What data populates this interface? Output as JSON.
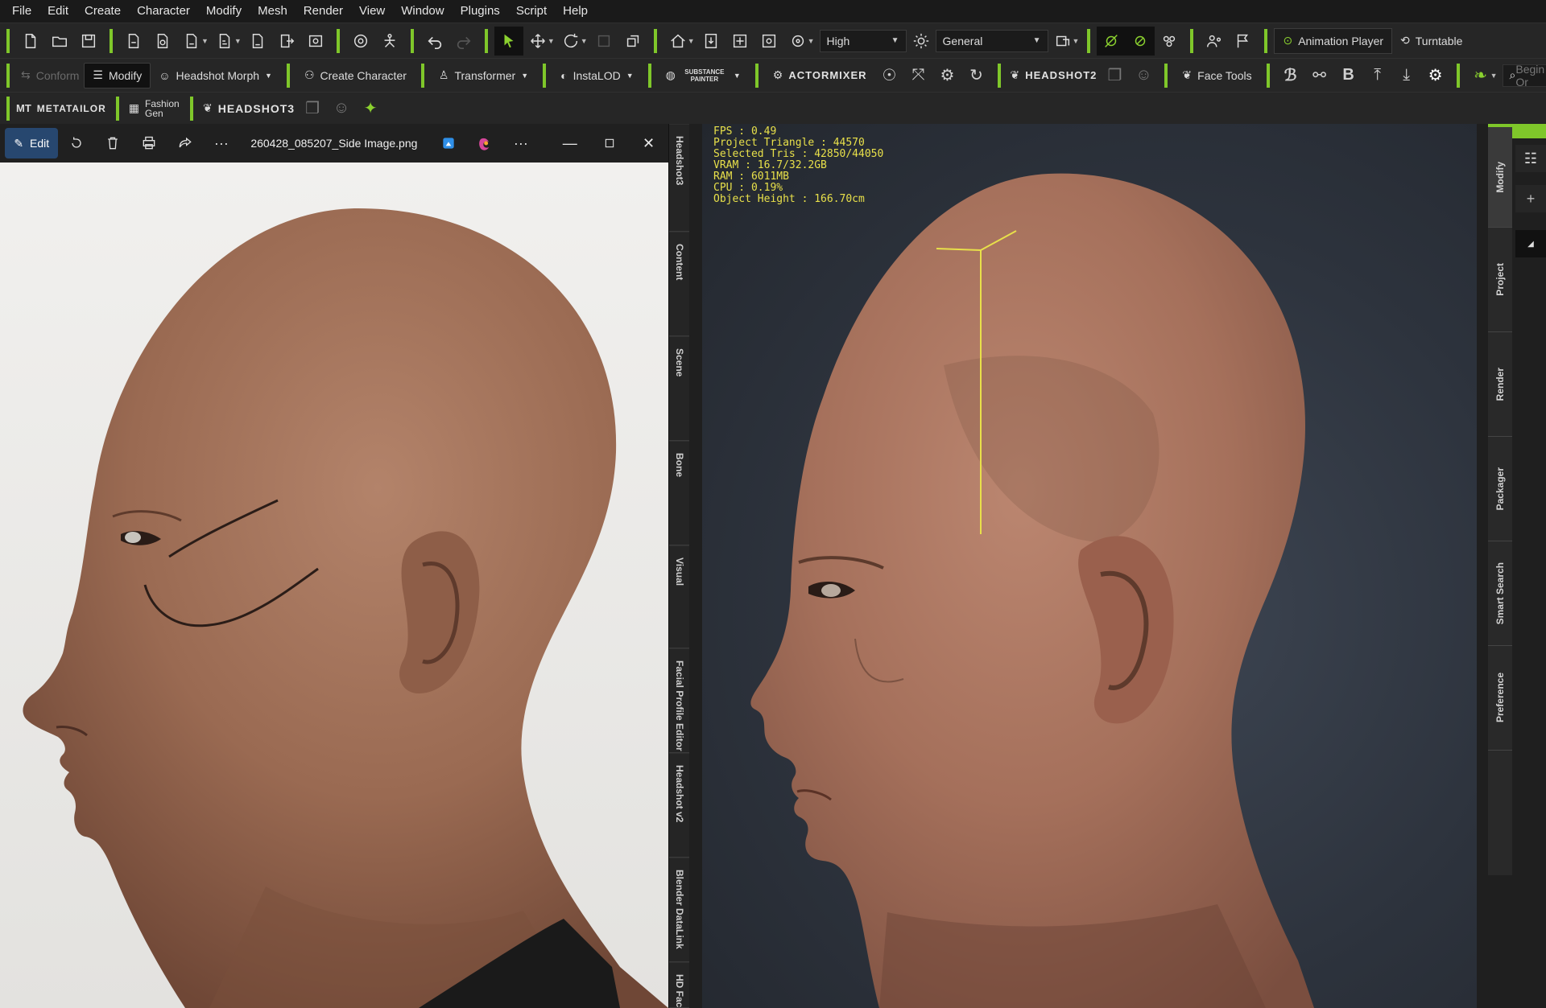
{
  "menu": [
    "File",
    "Edit",
    "Create",
    "Character",
    "Modify",
    "Mesh",
    "Render",
    "View",
    "Window",
    "Plugins",
    "Script",
    "Help"
  ],
  "toolbar1": {
    "quality_value": "High",
    "mode_value": "General",
    "animation_player_label": "Animation Player",
    "turntable_label": "Turntable",
    "icons": [
      "new-file-icon",
      "open-folder-icon",
      "save-icon",
      "import-icon",
      "export-icon",
      "undo-icon",
      "redo-icon",
      "select-icon",
      "move-icon",
      "rotate-icon",
      "scale-icon",
      "home-icon",
      "light-icon"
    ]
  },
  "toolbar2": {
    "conform_label": "Conform",
    "modify_label": "Modify",
    "headshot_morph_label": "Headshot Morph",
    "create_character_label": "Create Character",
    "transformer_label": "Transformer",
    "instalod_label": "InstaLOD",
    "substance_label": "SUBSTANCE PAINTER",
    "actormixer_label": "ACTORMIXER",
    "headshot2_label": "HEADSHOT2",
    "face_tools_label": "Face Tools",
    "search_placeholder": "Begin Or"
  },
  "toolbar3": {
    "metatailor_label": "METATAILOR",
    "fashion_gen_label": "Fashion Gen",
    "headshot3_label": "HEADSHOT3"
  },
  "photos": {
    "edit_label": "Edit",
    "filename": "260428_085207_Side Image.png"
  },
  "left_tabs": [
    "Headshot3",
    "Content",
    "Scene",
    "Bone",
    "Visual",
    "Facial Profile Editor",
    "Headshot v2",
    "Blender DataLink",
    "HD Face"
  ],
  "viewport": {
    "stats": [
      "FPS : 0.49",
      "Project Triangle : 44570",
      "Selected Tris : 42850/44050",
      "VRAM : 16.7/32.2GB",
      "RAM : 6011MB",
      "CPU : 0.19%",
      "Object Height : 166.70cm"
    ]
  },
  "right_tabs": [
    "Modify",
    "Project",
    "Render",
    "Packager",
    "Smart Search",
    "Preference"
  ],
  "colors": {
    "accent_green": "#7fc72a",
    "stats_yellow": "#e8e04a",
    "photos_edit_blue": "#27476f"
  }
}
